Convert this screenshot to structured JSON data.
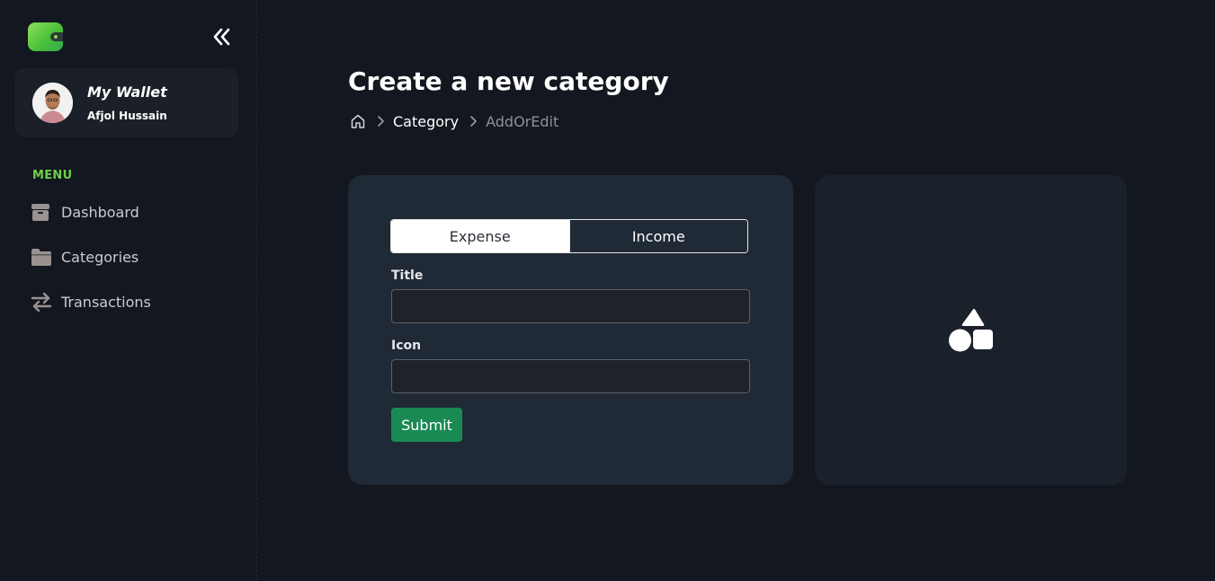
{
  "sidebar": {
    "profile": {
      "wallet_name": "My Wallet",
      "user_name": "Afjol Hussain"
    },
    "menu_heading": "MENU",
    "items": [
      {
        "label": "Dashboard",
        "icon": "box-icon"
      },
      {
        "label": "Categories",
        "icon": "folder-icon"
      },
      {
        "label": "Transactions",
        "icon": "arrows-swap-icon"
      }
    ]
  },
  "main": {
    "title": "Create a new category",
    "breadcrumb": {
      "items": [
        "Category",
        "AddOrEdit"
      ]
    },
    "form": {
      "type_options": [
        "Expense",
        "Income"
      ],
      "selected_type": "Expense",
      "title_label": "Title",
      "title_value": "",
      "icon_label": "Icon",
      "icon_value": "",
      "submit_label": "Submit"
    },
    "preview": {
      "icon": "shapes-icon"
    }
  },
  "colors": {
    "background": "#13171f",
    "accent_green": "#6ed04a",
    "submit_green": "#1a8a55",
    "card": "#202a36"
  }
}
